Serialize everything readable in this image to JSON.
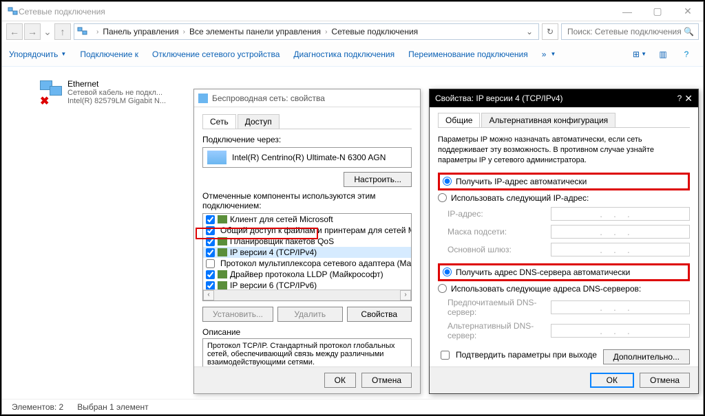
{
  "window": {
    "title": "Сетевые подключения",
    "elements_label": "Элементов:",
    "elements_count": "2",
    "selected_label": "Выбран 1 элемент"
  },
  "breadcrumbs": {
    "level1": "Панель управления",
    "level2": "Все элементы панели управления",
    "level3": "Сетевые подключения"
  },
  "search": {
    "placeholder": "Поиск: Сетевые подключения"
  },
  "toolbar": {
    "organize": "Упорядочить",
    "connect": "Подключение к",
    "disable": "Отключение сетевого устройства",
    "diagnose": "Диагностика подключения",
    "rename": "Переименование подключения"
  },
  "ethernet": {
    "name": "Ethernet",
    "status": "Сетевой кабель не подкл...",
    "device": "Intel(R) 82579LM Gigabit N..."
  },
  "wireless_tab": {
    "label": "Беспроводная сеть"
  },
  "props_dialog": {
    "title": "Беспроводная сеть: свойства",
    "tab_network": "Сеть",
    "tab_access": "Доступ",
    "connect_via": "Подключение через:",
    "adapter": "Intel(R) Centrino(R) Ultimate-N 6300 AGN",
    "configure_btn": "Настроить...",
    "components_label": "Отмеченные компоненты используются этим подключением:",
    "components": [
      "Клиент для сетей Microsoft",
      "Общий доступ к файлам и принтерам для сетей Mi",
      "Планировщик пакетов QoS",
      "IP версии 4 (TCP/IPv4)",
      "Протокол мультиплексора сетевого адаптера (Ма",
      "Драйвер протокола LLDP (Майкрософт)",
      "IP версии 6 (TCP/IPv6)"
    ],
    "install_btn": "Установить...",
    "uninstall_btn": "Удалить",
    "properties_btn": "Свойства",
    "desc_label": "Описание",
    "desc_text": "Протокол TCP/IP. Стандартный протокол глобальных сетей, обеспечивающий связь между различными взаимодействующими сетями.",
    "ok": "ОК",
    "cancel": "Отмена"
  },
  "ip_dialog": {
    "title": "Свойства: IP версии 4 (TCP/IPv4)",
    "tab_general": "Общие",
    "tab_alt": "Альтернативная конфигурация",
    "blurb": "Параметры IP можно назначать автоматически, если сеть поддерживает эту возможность. В противном случае узнайте параметры IP у сетевого администратора.",
    "radio_ip_auto": "Получить IP-адрес автоматически",
    "radio_ip_manual": "Использовать следующий IP-адрес:",
    "lbl_ip": "IP-адрес:",
    "lbl_mask": "Маска подсети:",
    "lbl_gw": "Основной шлюз:",
    "radio_dns_auto": "Получить адрес DNS-сервера автоматически",
    "radio_dns_manual": "Использовать следующие адреса DNS-серверов:",
    "lbl_dns1": "Предпочитаемый DNS-сервер:",
    "lbl_dns2": "Альтернативный DNS-сервер:",
    "chk_validate": "Подтвердить параметры при выходе",
    "advanced_btn": "Дополнительно...",
    "ok": "ОК",
    "cancel": "Отмена"
  }
}
